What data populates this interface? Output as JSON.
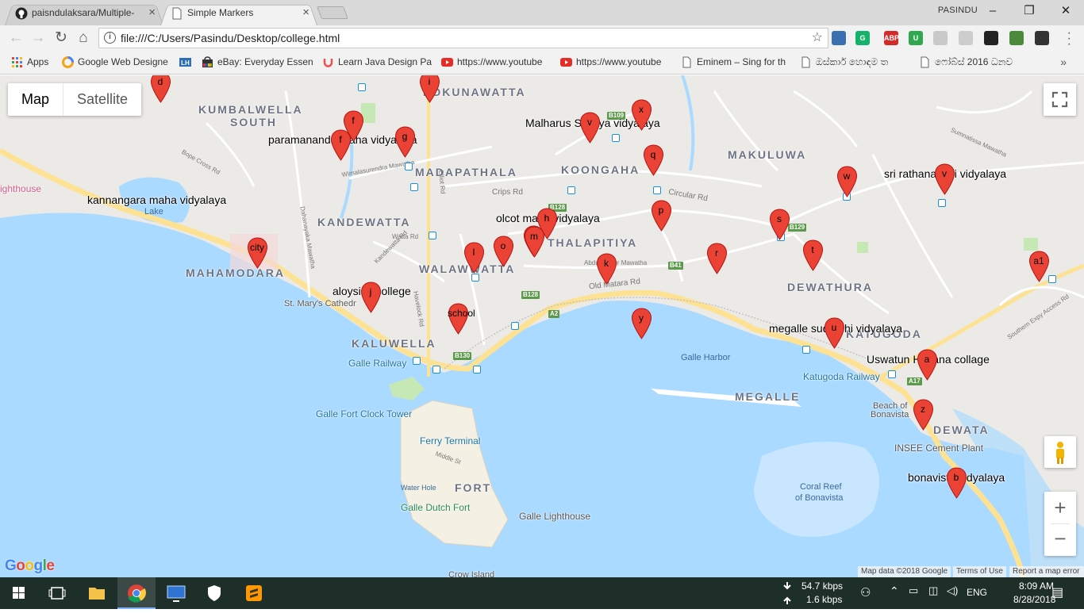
{
  "browser": {
    "tabs": [
      {
        "title": "paisndulaksara/Multiple-",
        "active": false
      },
      {
        "title": "Simple Markers",
        "active": true
      }
    ],
    "profile": "PASINDU",
    "url": "file:///C:/Users/Pasindu/Desktop/college.html",
    "bookmarks": [
      {
        "label": "Apps",
        "icon": "apps-grid-icon"
      },
      {
        "label": "Google Web Designe",
        "icon": "google-web-designer-icon"
      },
      {
        "label": "",
        "icon": "lh-icon"
      },
      {
        "label": "eBay: Everyday Essen",
        "icon": "ebay-icon"
      },
      {
        "label": "Learn Java Design Pa",
        "icon": "udemy-icon"
      },
      {
        "label": "https://www.youtube",
        "icon": "youtube-icon"
      },
      {
        "label": "https://www.youtube",
        "icon": "youtube-icon"
      },
      {
        "label": "Eminem – Sing for th",
        "icon": "page-icon"
      },
      {
        "label": "ඔස්කාර් හොඳම ත",
        "icon": "page-icon"
      },
      {
        "label": "ෆෝබ්ස් 2016 ධනව",
        "icon": "page-icon"
      }
    ],
    "more_bookmarks": "»",
    "extensions": [
      {
        "name": "ext-blue-icon",
        "text": "",
        "color": "#3a6fb0"
      },
      {
        "name": "grammarly-icon",
        "text": "G",
        "color": "#15b36a"
      },
      {
        "name": "adblock-plus-icon",
        "text": "ABP",
        "color": "#d52a2a"
      },
      {
        "name": "ext-u-icon",
        "text": "U",
        "color": "#2fa84f"
      },
      {
        "name": "pdf-icon",
        "text": "",
        "color": "#c9c9c9"
      },
      {
        "name": "ext-gray-icon",
        "text": "",
        "color": "#cdcdcd"
      },
      {
        "name": "ext-dark-icon",
        "text": "",
        "color": "#222"
      },
      {
        "name": "ext-globe-icon",
        "text": "",
        "color": "#4a8a3a"
      },
      {
        "name": "ext-loop-icon",
        "text": "",
        "color": "#333"
      }
    ]
  },
  "map": {
    "map_type_options": [
      "Map",
      "Satellite"
    ],
    "selected_map_type": "Map",
    "area_labels": [
      "KUMBALWELLA",
      "SOUTH",
      "MADAPATHALA",
      "KOONGAHA",
      "MAKULUWA",
      "KANDEWATTA",
      "THALAPITIYA",
      "MAHAMODARA",
      "WALAWWATTA",
      "DEWATHURA",
      "KALUWELLA",
      "KATUGODA",
      "MEGALLE",
      "DEWATA",
      "FORT",
      "POKUNAWATTA"
    ],
    "poi_labels": [
      "St. Mary's Cathedr",
      "Galle Railway",
      "Galle Fort Clock Tower",
      "Ferry Terminal",
      "Galle Dutch Fort",
      "Galle Lighthouse",
      "Galle Harbor",
      "Katugoda Railway",
      "Beach of",
      "Bonavista",
      "INSEE Cement Plant",
      "Coral Reef",
      "of Bonavista",
      "Water Hole",
      "Crow Island",
      "ighthouse",
      "Lake"
    ],
    "streets": [
      "Bope Cross Rd",
      "Wimalasurendra Mawatha",
      "Dahanayaka Mawatha",
      "Watta Rd",
      "Kandewatta Rd",
      "Havelock Rd",
      "Crips Rd",
      "Circular Rd",
      "Old Matara Rd",
      "Abdul Cader Mawatha",
      "Sumnatissa Mawatha",
      "Southern Expy Access Rd",
      "Middle St",
      "Elliot Rd"
    ],
    "road_badges": [
      "B109",
      "B128",
      "B128",
      "B41",
      "B129",
      "A2",
      "B130",
      "A17"
    ],
    "markers": [
      {
        "label": "d"
      },
      {
        "label": "f"
      },
      {
        "label": "f"
      },
      {
        "label": "g"
      },
      {
        "label": "i"
      },
      {
        "label": "x"
      },
      {
        "label": "v"
      },
      {
        "label": "q"
      },
      {
        "label": "w"
      },
      {
        "label": "v"
      },
      {
        "label": "h"
      },
      {
        "label": "p"
      },
      {
        "label": "n"
      },
      {
        "label": "m"
      },
      {
        "label": "o"
      },
      {
        "label": "l"
      },
      {
        "label": "k"
      },
      {
        "label": "s"
      },
      {
        "label": "city"
      },
      {
        "label": "r"
      },
      {
        "label": "t"
      },
      {
        "label": "a1"
      },
      {
        "label": "j"
      },
      {
        "label": "y"
      },
      {
        "label": "school"
      },
      {
        "label": "u"
      },
      {
        "label": "a"
      },
      {
        "label": "z"
      },
      {
        "label": "b"
      }
    ],
    "marker_titles": [
      "paramananda maha vidyalaya",
      "kannangara maha vidyalaya",
      "Malharus Sulhiya vidyalaya",
      "sri rathanajothi vidyalaya",
      "olcot maha vidyalaya",
      "aloysius college",
      "megalle sudarshi vidyalaya",
      "Uswatun Hasana collage",
      "bonavista vidyalaya"
    ],
    "attribution": {
      "data": "Map data ©2018 Google",
      "terms": "Terms of Use",
      "report": "Report a map error"
    },
    "google_logo": "Google"
  },
  "taskbar": {
    "net_down": "54.7 kbps",
    "net_up": "1.6 kbps",
    "language": "ENG",
    "time": "8:09 AM",
    "date": "8/28/2018"
  },
  "colors": {
    "marker": "#ea4335",
    "water": "#aadaff",
    "land": "#eceae6",
    "major_road": "#fde293",
    "taskbar": "#1e2f2a"
  }
}
